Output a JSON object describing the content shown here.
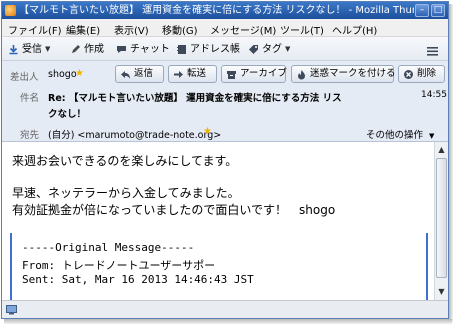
{
  "titlebar": {
    "title": "【マルモト言いたい放題】 運用資金を確実に倍にする方法 リスクなし！ - Mozilla Thunderbird"
  },
  "menubar": {
    "items": [
      "ファイル(F)",
      "編集(E)",
      "表示(V)",
      "移動(G)",
      "メッセージ(M)",
      "ツール(T)",
      "ヘルプ(H)"
    ]
  },
  "toolbar": {
    "receive": "受信",
    "compose": "作成",
    "chat": "チャット",
    "addressbook": "アドレス帳",
    "tag": "タグ"
  },
  "header": {
    "from_label": "差出人",
    "from_value": "shogo",
    "reply": "返信",
    "forward": "転送",
    "archive": "アーカイブ",
    "junk": "迷惑マークを付ける",
    "delete": "削除",
    "subject_label": "件名",
    "subject_line1": "Re: 【マルモト言いたい放題】 運用資金を確実に倍にする方法 リス",
    "subject_line2": "クなし！",
    "time": "14:55",
    "to_label": "宛先",
    "to_value": "(自分) <marumoto@trade-note.org>",
    "other_actions": "その他の操作"
  },
  "message": {
    "lines": [
      "来週お会いできるのを楽しみにしてます。",
      "早速、ネッテラーから入金してみました。",
      "有効証拠金が倍になっていましたので面白いです！　shogo"
    ],
    "quote": [
      "-----Original Message-----",
      "From: トレードノートユーザーサポー",
      "Sent: Sat, Mar 16 2013 14:46:43 JST"
    ]
  },
  "colors": {
    "titlebar": "#1d4f9c",
    "header_bg": "#e4ebf4",
    "quote_bar": "#3f6fd1",
    "star": "#f0b400"
  }
}
